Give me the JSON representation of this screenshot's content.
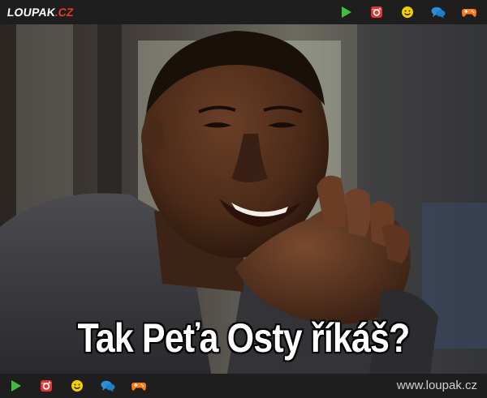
{
  "header": {
    "logo_main": "LOUPAK",
    "logo_suffix": ".CZ",
    "icons": [
      "play-icon",
      "instagram-icon",
      "smiley-icon",
      "chat-icon",
      "gamepad-icon"
    ]
  },
  "meme": {
    "caption": "Tak Peťa Osty říkáš?"
  },
  "footer": {
    "icons": [
      "play-icon",
      "instagram-icon",
      "smiley-icon",
      "chat-icon",
      "gamepad-icon"
    ],
    "site_url": "www.loupak.cz"
  },
  "colors": {
    "bar_bg": "#1e1e1e",
    "play": "#3fbf3f",
    "instagram": "#e4322f",
    "smiley": "#f5d000",
    "chat": "#2a8fd8",
    "gamepad": "#ff7a1a",
    "logo_accent": "#e43a2e"
  }
}
